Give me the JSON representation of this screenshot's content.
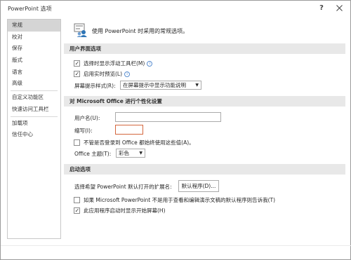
{
  "window": {
    "title": "PowerPoint 选项",
    "help_label": "?"
  },
  "nav": {
    "items": [
      {
        "label": "常规",
        "active": true
      },
      {
        "label": "校对"
      },
      {
        "label": "保存"
      },
      {
        "label": "版式"
      },
      {
        "label": "语言"
      },
      {
        "label": "高级"
      },
      {
        "label": "自定义功能区"
      },
      {
        "label": "快速访问工具栏"
      },
      {
        "label": "加载项"
      },
      {
        "label": "信任中心"
      }
    ]
  },
  "intro": {
    "text": "使用 PowerPoint 时采用的常规选项。"
  },
  "ui_options": {
    "header": "用户界面选项",
    "mini_toolbar": {
      "label": "选择时显示浮动工具栏(M)",
      "checked": true
    },
    "live_preview": {
      "label": "启用实时预览(L)",
      "checked": true
    },
    "screentip": {
      "label": "屏幕提示样式(R):",
      "value": "在屏幕提示中显示功能说明"
    }
  },
  "personalize": {
    "header": "对 Microsoft Office 进行个性化设置",
    "username_label": "用户名(U):",
    "username_value": "",
    "initials_label": "缩写(I):",
    "initials_value": "",
    "always_use": {
      "label": "不管是否登录到 Office 都始终使用这些值(A)。",
      "checked": false
    },
    "theme_label": "Office 主题(T):",
    "theme_value": "彩色"
  },
  "startup": {
    "header": "启动选项",
    "ext_label": "选择希望 PowerPoint 默认打开的扩展名:",
    "default_programs_button": "默认程序(D)...",
    "tell_me": {
      "label": "如果 Microsoft PowerPoint 不是用于查看和编辑演示文稿的默认程序则告诉我(T)",
      "checked": false
    },
    "show_start": {
      "label": "此应用程序启动时显示开始屏幕(H)",
      "checked": true
    }
  },
  "colors": {
    "section_bg": "#e8e8e8",
    "nav_active": "#d5d5d5",
    "focus_border": "#d4663d",
    "info_blue": "#5a8ed0"
  }
}
